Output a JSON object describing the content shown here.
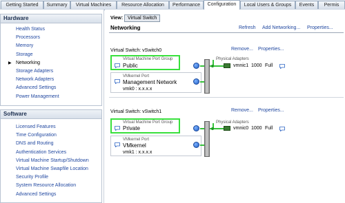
{
  "tabs": [
    "Getting Started",
    "Summary",
    "Virtual Machines",
    "Resource Allocation",
    "Performance",
    "Configuration",
    "Local Users & Groups",
    "Events",
    "Permis"
  ],
  "active_tab": "Configuration",
  "hardware": {
    "title": "Hardware",
    "items": [
      "Health Status",
      "Processors",
      "Memory",
      "Storage",
      "Networking",
      "Storage Adapters",
      "Network Adapters",
      "Advanced Settings",
      "Power Management"
    ],
    "selected": "Networking"
  },
  "software": {
    "title": "Software",
    "items": [
      "Licensed Features",
      "Time Configuration",
      "DNS and Routing",
      "Authentication Services",
      "Virtual Machine Startup/Shutdown",
      "Virtual Machine Swapfile Location",
      "Security Profile",
      "System Resource Allocation",
      "Advanced Settings"
    ]
  },
  "view": {
    "label": "View:",
    "button": "Virtual Switch"
  },
  "networking": {
    "title": "Networking",
    "refresh": "Refresh",
    "add": "Add Networking...",
    "properties": "Properties..."
  },
  "switches": [
    {
      "title": "Virtual Switch: vSwitch0",
      "remove": "Remove...",
      "properties": "Properties...",
      "vm_group_type": "Virtual Machine Port Group",
      "vm_group_name": "Public",
      "vmk_type": "VMkernel Port",
      "vmk_name": "Management Network",
      "vmk_ip": "vmk0 : x.x.x.x",
      "adapters_label": "Physical Adapters",
      "nic": "vmnic1",
      "speed": "1000",
      "duplex": "Full"
    },
    {
      "title": "Virtual Switch: vSwitch1",
      "remove": "Remove...",
      "properties": "Properties...",
      "vm_group_type": "Virtual Machine Port Group",
      "vm_group_name": "Private",
      "vmk_type": "VMkernel Port",
      "vmk_name": "VMkernel",
      "vmk_ip": "vmk1 : x.x.x.x",
      "adapters_label": "Physical Adapters",
      "nic": "vmnic0",
      "speed": "1000",
      "duplex": "Full"
    }
  ],
  "colors": {
    "highlight": "#38e03c",
    "link": "#2148a0",
    "header": "#1c2f4f"
  }
}
